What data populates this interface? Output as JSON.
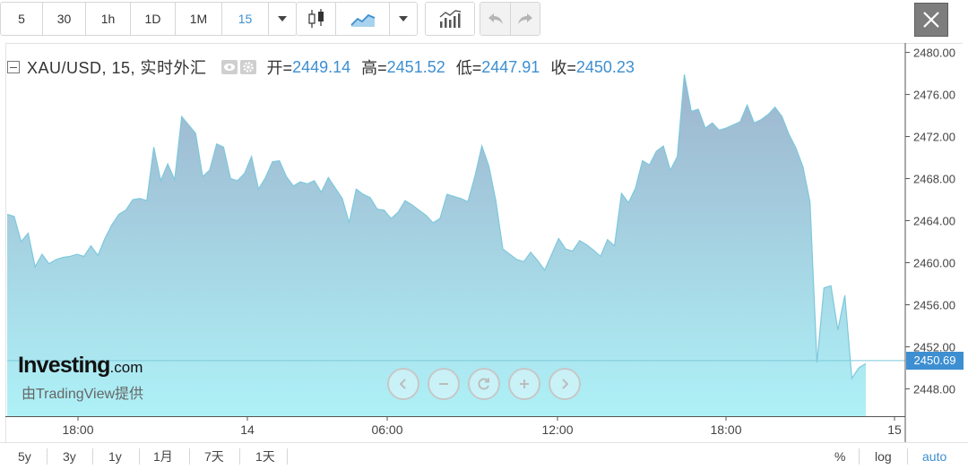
{
  "toolbar": {
    "intervals": [
      "5",
      "30",
      "1h",
      "1D",
      "1M",
      "15"
    ],
    "active_interval": "15",
    "icons": {
      "interval_menu": "caret-down-icon",
      "candles": "candlestick-icon",
      "area": "area-chart-icon",
      "style_menu": "caret-down-icon",
      "indicators": "indicators-icon",
      "undo": "undo-icon",
      "redo": "redo-icon",
      "close": "close-icon"
    }
  },
  "legend": {
    "symbol": "XAU/USD, 15, 实时外汇",
    "open_label": "开=",
    "open": "2449.14",
    "high_label": "高=",
    "high": "2451.52",
    "low_label": "低=",
    "low": "2447.91",
    "close_label": "收=",
    "close": "2450.23"
  },
  "colors": {
    "accent": "#3d8fd1",
    "area_top": "#9db4cd",
    "area_bottom": "#aef1f7",
    "line": "#7ec8dc"
  },
  "last_price": "2450.69",
  "branding": {
    "logo_main": "Investing",
    "logo_suffix": ".com",
    "provider": "由TradingView提供"
  },
  "bottom_bar": {
    "ranges": [
      "5y",
      "3y",
      "1y",
      "1月",
      "7天",
      "1天"
    ],
    "options": [
      "%",
      "log",
      "auto"
    ],
    "active_option": "auto"
  },
  "chart_data": {
    "type": "area",
    "title": "XAU/USD, 15, 实时外汇",
    "series": [
      {
        "values": [
          2464.6,
          2464.4,
          2462.0,
          2462.8,
          2459.6,
          2460.8,
          2459.9,
          2460.3,
          2460.5,
          2460.6,
          2460.8,
          2460.6,
          2461.6,
          2460.7,
          2462.3,
          2463.6,
          2464.6,
          2465.0,
          2466.0,
          2466.1,
          2465.9,
          2471.0,
          2467.8,
          2469.4,
          2467.9,
          2473.9,
          2473.1,
          2472.3,
          2468.2,
          2468.8,
          2471.3,
          2471.0,
          2468.0,
          2467.8,
          2468.5,
          2470.1,
          2467.0,
          2468.1,
          2469.6,
          2469.7,
          2468.2,
          2467.3,
          2467.7,
          2467.5,
          2467.8,
          2466.7,
          2468.1,
          2467.1,
          2466.1,
          2463.8,
          2467.0,
          2466.5,
          2466.2,
          2465.1,
          2465.0,
          2464.2,
          2464.8,
          2465.9,
          2465.5,
          2465.0,
          2464.5,
          2463.8,
          2464.2,
          2466.5,
          2466.3,
          2466.1,
          2465.8,
          2468.2,
          2471.1,
          2469.2,
          2465.9,
          2461.3,
          2460.8,
          2460.3,
          2460.1,
          2461.0,
          2460.2,
          2459.3,
          2460.8,
          2462.3,
          2461.3,
          2461.1,
          2462.1,
          2461.7,
          2461.2,
          2460.6,
          2462.2,
          2461.6,
          2466.6,
          2465.7,
          2467.1,
          2469.7,
          2469.3,
          2470.6,
          2471.1,
          2468.8,
          2470.1,
          2477.9,
          2474.4,
          2474.6,
          2472.8,
          2473.3,
          2472.6,
          2472.8,
          2473.1,
          2473.4,
          2475.0,
          2473.3,
          2473.6,
          2474.1,
          2474.8,
          2473.9,
          2472.2,
          2470.9,
          2469.1,
          2465.8,
          2450.5,
          2457.6,
          2457.8,
          2453.6,
          2456.9,
          2449.0,
          2450.0,
          2450.4
        ]
      }
    ],
    "x_tick_labels": [
      "18:00",
      "14",
      "06:00",
      "12:00",
      "18:00",
      "15"
    ],
    "y_tick_labels": [
      "2448.00",
      "2452.00",
      "2456.00",
      "2460.00",
      "2464.00",
      "2468.00",
      "2472.00",
      "2476.00",
      "2480.00"
    ],
    "ylim": [
      2445.4,
      2480.9
    ],
    "last_value": 2450.69,
    "grid": false
  }
}
